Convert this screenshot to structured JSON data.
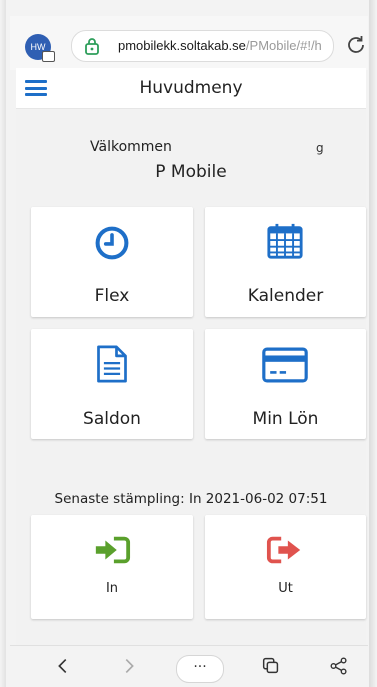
{
  "browser": {
    "avatar_initials": "HW",
    "url_host": "pmobilekk.soltakab.se",
    "url_path": "/PMobile/#!/h"
  },
  "header": {
    "title": "Huvudmeny"
  },
  "welcome": {
    "greeting": "Välkommen",
    "fragment": "g",
    "company": "P Mobile"
  },
  "tiles": {
    "flex": "Flex",
    "kalender": "Kalender",
    "saldon": "Saldon",
    "min_lon": "Min Lön"
  },
  "stamp": {
    "last_stamp_text": "Senaste stämpling: In 2021-06-02 07:51",
    "in_label": "In",
    "out_label": "Ut"
  },
  "bottom_nav": {
    "more_label": "···"
  },
  "colors": {
    "accent_blue": "#1e6fc8",
    "in_green": "#5aa02c",
    "out_red": "#e0534e"
  }
}
